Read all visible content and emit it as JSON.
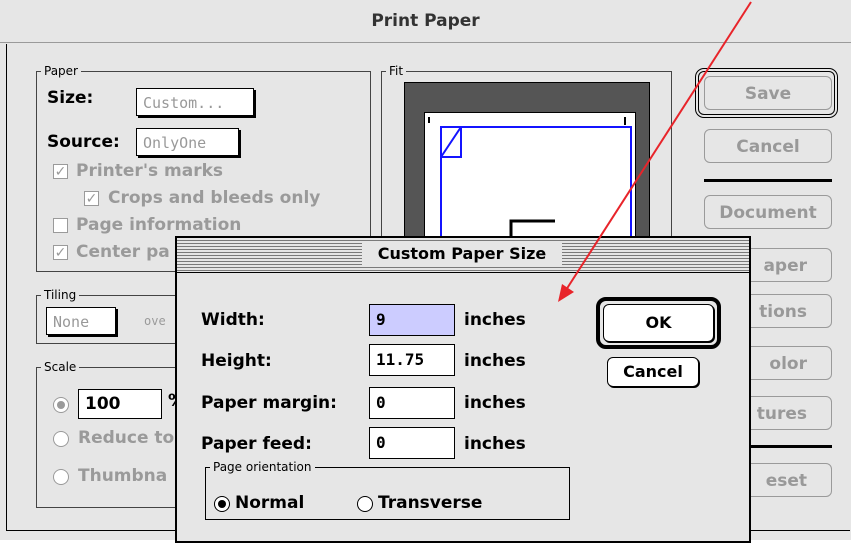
{
  "window": {
    "title": "Print Paper"
  },
  "paper_group": {
    "legend": "Paper",
    "size_label": "Size:",
    "size_value": "Custom...",
    "source_label": "Source:",
    "source_value": "OnlyOne",
    "printers_marks": "Printer's marks",
    "crops_bleeds": "Crops and bleeds only",
    "page_information": "Page information",
    "center_page": "Center pa"
  },
  "fit_group": {
    "legend": "Fit"
  },
  "tiling_group": {
    "legend": "Tiling",
    "value": "None",
    "overlap_partial": "ove"
  },
  "scale_group": {
    "legend": "Scale",
    "value": "100",
    "percent_partial": "%",
    "reduce_partial": "Reduce to",
    "thumbnails_partial": "Thumbna"
  },
  "side_buttons": {
    "save": "Save",
    "cancel": "Cancel",
    "document": "Document",
    "paper_partial": "aper",
    "options_partial": "tions",
    "color_partial": "olor",
    "features_partial": "tures",
    "reset_partial": "eset"
  },
  "dialog": {
    "title": "Custom Paper Size",
    "width_label": "Width:",
    "width_value": "9",
    "height_label": "Height:",
    "height_value": "11.75",
    "margin_label": "Paper margin:",
    "margin_value": "0",
    "feed_label": "Paper feed:",
    "feed_value": "0",
    "unit": "inches",
    "ok": "OK",
    "cancel": "Cancel",
    "orientation_legend": "Page orientation",
    "normal": "Normal",
    "transverse": "Transverse"
  },
  "annotation": {
    "color": "#e8242a"
  },
  "colors": {
    "accent_blue": "#1414ff",
    "field_highlight": "#ccccff"
  }
}
